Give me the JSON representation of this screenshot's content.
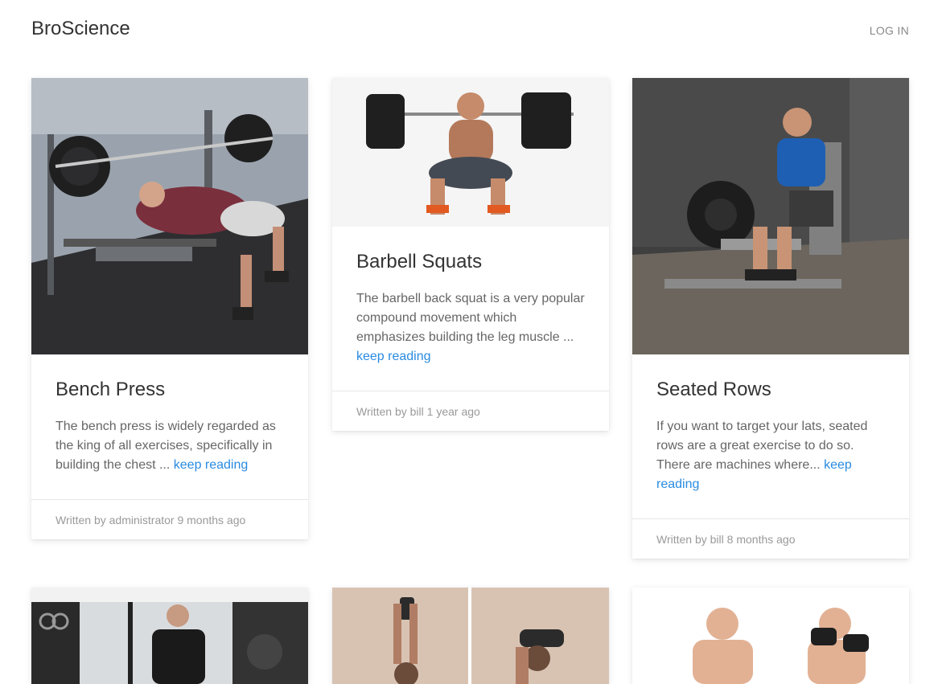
{
  "header": {
    "brand": "BroScience",
    "login_label": "LOG IN"
  },
  "colors": {
    "link": "#2a8be0",
    "text": "#333333",
    "muted": "#999999"
  },
  "posts": [
    {
      "title": "Bench Press",
      "excerpt": "The bench press is widely regarded as the king of all exercises, specifically in building the chest ...",
      "more_label": "keep reading",
      "footer": "Written by administrator 9 months ago",
      "image": "man-bench-pressing-barbell-photo"
    },
    {
      "title": "Barbell Squats",
      "excerpt": "The barbell back squat is a very popular compound movement which emphasizes building the leg muscle ...",
      "more_label": "keep reading",
      "footer": "Written by bill 1 year ago",
      "image": "man-squatting-barbell-photo"
    },
    {
      "title": "Seated Rows",
      "excerpt": "If you want to target your lats, seated rows are a great exercise to do so. There are machines where...",
      "more_label": "keep reading",
      "footer": "Written by bill 8 months ago",
      "image": "man-on-seated-row-machine-photo"
    },
    {
      "image": "man-in-gym-photo"
    },
    {
      "image": "overhead-dumbbell-extension-photo"
    },
    {
      "image": "dumbbell-curl-photo"
    }
  ]
}
